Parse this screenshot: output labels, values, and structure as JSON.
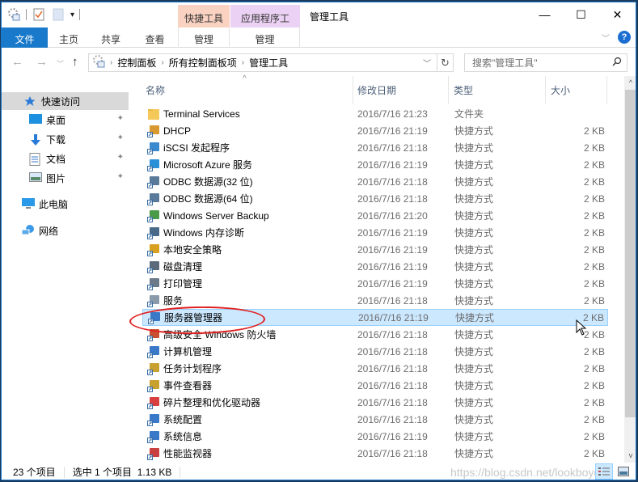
{
  "window": {
    "title": "管理工具",
    "controls": {
      "minimize": "—",
      "maximize": "☐",
      "close": "✕"
    }
  },
  "ribbon": {
    "context_tabs": [
      {
        "label": "快捷工具",
        "color": "#f9d2c1"
      },
      {
        "label": "应用程序工具",
        "color": "#ebd1f3"
      }
    ],
    "tabs": [
      {
        "label": "文件",
        "active": true
      },
      {
        "label": "主页"
      },
      {
        "label": "共享"
      },
      {
        "label": "查看"
      },
      {
        "label": "管理"
      },
      {
        "label": "管理"
      }
    ],
    "help_label": "?",
    "expand_icon": "﹀"
  },
  "nav": {
    "back": "←",
    "forward": "→",
    "recent": "﹀",
    "up": "↑",
    "breadcrumb": [
      "控制面板",
      "所有控制面板项",
      "管理工具"
    ],
    "refresh": "↻",
    "search_placeholder": "搜索\"管理工具\"",
    "search_icon": "⚲"
  },
  "sidebar": {
    "items": [
      {
        "label": "快速访问",
        "icon": "star-icon",
        "selected": true
      },
      {
        "label": "桌面",
        "icon": "desktop-icon",
        "pinned": true
      },
      {
        "label": "下载",
        "icon": "download-icon",
        "pinned": true
      },
      {
        "label": "文档",
        "icon": "document-icon",
        "pinned": true
      },
      {
        "label": "图片",
        "icon": "pictures-icon",
        "pinned": true
      },
      {
        "label": "此电脑",
        "icon": "computer-icon"
      },
      {
        "label": "网络",
        "icon": "network-icon"
      }
    ],
    "pin_glyph": "📌"
  },
  "list": {
    "columns": [
      "名称",
      "修改日期",
      "类型",
      "大小"
    ],
    "sort_glyph": "^",
    "rows": [
      {
        "name": "Terminal Services",
        "date": "2016/7/16 21:23",
        "type": "文件夹",
        "size": "",
        "icon": "folder"
      },
      {
        "name": "DHCP",
        "date": "2016/7/16 21:19",
        "type": "快捷方式",
        "size": "2 KB",
        "icon": "dhcp"
      },
      {
        "name": "iSCSI 发起程序",
        "date": "2016/7/16 21:18",
        "type": "快捷方式",
        "size": "2 KB",
        "icon": "iscsi"
      },
      {
        "name": "Microsoft Azure 服务",
        "date": "2016/7/16 21:19",
        "type": "快捷方式",
        "size": "2 KB",
        "icon": "azure"
      },
      {
        "name": "ODBC 数据源(32 位)",
        "date": "2016/7/16 21:18",
        "type": "快捷方式",
        "size": "2 KB",
        "icon": "odbc"
      },
      {
        "name": "ODBC 数据源(64 位)",
        "date": "2016/7/16 21:18",
        "type": "快捷方式",
        "size": "2 KB",
        "icon": "odbc"
      },
      {
        "name": "Windows Server Backup",
        "date": "2016/7/16 21:20",
        "type": "快捷方式",
        "size": "2 KB",
        "icon": "backup"
      },
      {
        "name": "Windows 内存诊断",
        "date": "2016/7/16 21:19",
        "type": "快捷方式",
        "size": "2 KB",
        "icon": "memory"
      },
      {
        "name": "本地安全策略",
        "date": "2016/7/16 21:19",
        "type": "快捷方式",
        "size": "2 KB",
        "icon": "security"
      },
      {
        "name": "磁盘清理",
        "date": "2016/7/16 21:19",
        "type": "快捷方式",
        "size": "2 KB",
        "icon": "disk"
      },
      {
        "name": "打印管理",
        "date": "2016/7/16 21:19",
        "type": "快捷方式",
        "size": "2 KB",
        "icon": "print"
      },
      {
        "name": "服务",
        "date": "2016/7/16 21:18",
        "type": "快捷方式",
        "size": "2 KB",
        "icon": "services"
      },
      {
        "name": "服务器管理器",
        "date": "2016/7/16 21:19",
        "type": "快捷方式",
        "size": "2 KB",
        "icon": "server-manager",
        "selected": true
      },
      {
        "name": "高级安全 Windows 防火墙",
        "date": "2016/7/16 21:18",
        "type": "快捷方式",
        "size": "2 KB",
        "icon": "firewall"
      },
      {
        "name": "计算机管理",
        "date": "2016/7/16 21:18",
        "type": "快捷方式",
        "size": "2 KB",
        "icon": "computer-mgmt"
      },
      {
        "name": "任务计划程序",
        "date": "2016/7/16 21:18",
        "type": "快捷方式",
        "size": "2 KB",
        "icon": "task-scheduler"
      },
      {
        "name": "事件查看器",
        "date": "2016/7/16 21:18",
        "type": "快捷方式",
        "size": "2 KB",
        "icon": "event-viewer"
      },
      {
        "name": "碎片整理和优化驱动器",
        "date": "2016/7/16 21:18",
        "type": "快捷方式",
        "size": "2 KB",
        "icon": "defrag"
      },
      {
        "name": "系统配置",
        "date": "2016/7/16 21:18",
        "type": "快捷方式",
        "size": "2 KB",
        "icon": "msconfig"
      },
      {
        "name": "系统信息",
        "date": "2016/7/16 21:19",
        "type": "快捷方式",
        "size": "2 KB",
        "icon": "sysinfo"
      },
      {
        "name": "性能监视器",
        "date": "2016/7/16 21:18",
        "type": "快捷方式",
        "size": "2 KB",
        "icon": "perfmon"
      }
    ]
  },
  "scrollbar": {
    "up": "^",
    "down": "v"
  },
  "status": {
    "item_count": "23 个项目",
    "selection": "选中 1 个项目  1.13 KB",
    "watermark": "https://blog.csdn.net/lookboydfor"
  },
  "colors": {
    "accent": "#1979ca",
    "selection_bg": "#cce8ff",
    "selection_border": "#99d1ff",
    "annotation": "#e02020"
  }
}
